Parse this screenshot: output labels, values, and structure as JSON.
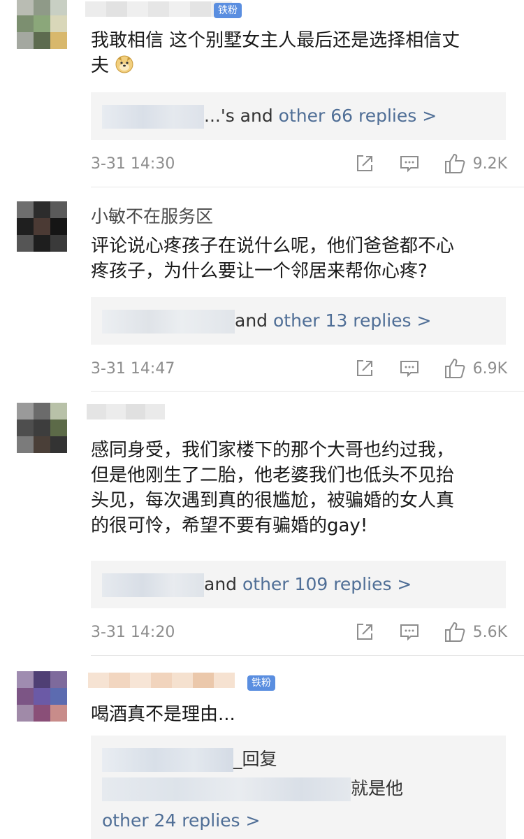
{
  "comments": [
    {
      "badge": "铁粉",
      "text_lines": [
        "我敢相信 这个别墅女主人最后还是选择相信丈",
        "夫"
      ],
      "emoji_icon": "doge-emoji-icon",
      "reply": {
        "prefix": "...'s and ",
        "link": "other 66 replies >"
      },
      "time": "3-31 14:30",
      "likes": "9.2K"
    },
    {
      "username": "小敏不在服务区",
      "text_lines": [
        "评论说心疼孩子在说什么呢，他们爸爸都不心",
        "疼孩子，为什么要让一个邻居来帮你心疼?"
      ],
      "reply": {
        "prefix": "and ",
        "link": "other 13 replies >"
      },
      "time": "3-31 14:47",
      "likes": "6.9K"
    },
    {
      "text_lines": [
        "感同身受，我们家楼下的那个大哥也约过我，",
        "但是他刚生了二胎，他老婆我们也低头不见抬",
        "头见，每次遇到真的很尴尬，被骗婚的女人真",
        "的很可怜，希望不要有骗婚的gay!"
      ],
      "reply": {
        "prefix": "and ",
        "link": "other 109 replies >"
      },
      "time": "3-31 14:20",
      "likes": "5.6K"
    },
    {
      "badge": "铁粉",
      "text_lines": [
        "喝酒真不是理由..."
      ],
      "reply": {
        "line1_suffix": "_回复",
        "line2_suffix": "就是他",
        "link": "other 24 replies >"
      }
    }
  ],
  "icons": {
    "share": "share-icon",
    "comment": "comment-icon",
    "like": "thumbs-up-icon"
  },
  "colors": {
    "link": "#4f6e96",
    "badge": "#5a8ee0",
    "meta": "#8d8d8d",
    "reply_bg": "#f4f4f4"
  }
}
